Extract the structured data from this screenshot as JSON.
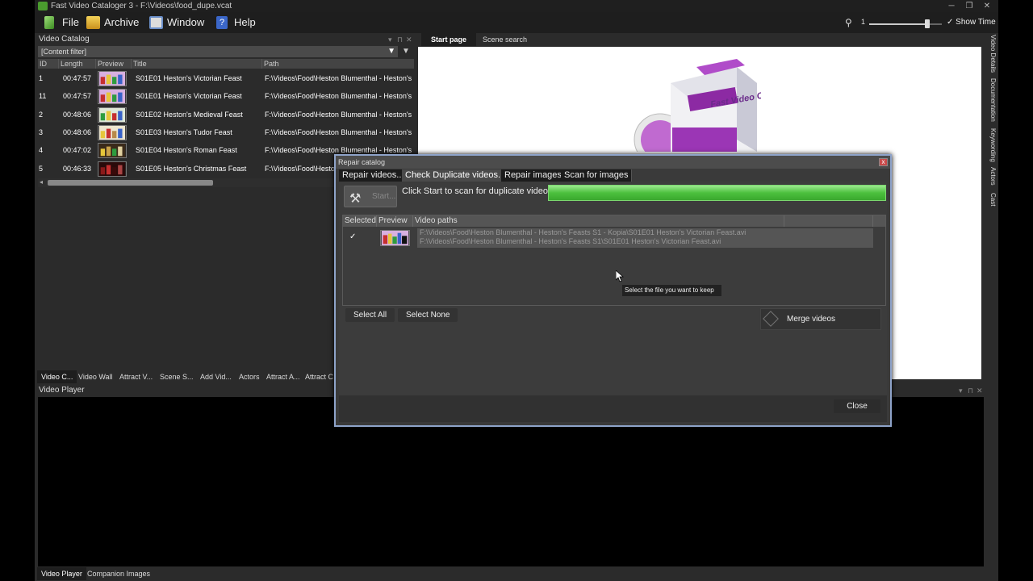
{
  "window": {
    "title": "Fast Video Cataloger 3 - F:\\Videos\\food_dupe.vcat"
  },
  "menu": {
    "file": "File",
    "archive": "Archive",
    "window": "Window",
    "help": "Help"
  },
  "toolbar": {
    "zoom_label": "1",
    "zoom_fraction": 0.8,
    "show_time": "Show Time",
    "show_time_check": "✓"
  },
  "catalog": {
    "title": "Video Catalog",
    "filter": "[Content filter]",
    "columns": {
      "id": "ID",
      "length": "Length",
      "preview": "Preview",
      "title": "Title",
      "path": "Path"
    },
    "rows": [
      {
        "id": "1",
        "length": "00:47:57",
        "title": "S01E01 Heston's Victorian Feast",
        "path": "F:\\Videos\\Food\\Heston Blumenthal - Heston's Fe"
      },
      {
        "id": "11",
        "length": "00:47:57",
        "title": "S01E01 Heston's Victorian Feast",
        "path": "F:\\Videos\\Food\\Heston Blumenthal - Heston's Fe"
      },
      {
        "id": "2",
        "length": "00:48:06",
        "title": "S01E02 Heston's Medieval Feast",
        "path": "F:\\Videos\\Food\\Heston Blumenthal - Heston's Fe"
      },
      {
        "id": "3",
        "length": "00:48:06",
        "title": "S01E03 Heston's Tudor Feast",
        "path": "F:\\Videos\\Food\\Heston Blumenthal - Heston's Fe"
      },
      {
        "id": "4",
        "length": "00:47:02",
        "title": "S01E04 Heston's Roman Feast",
        "path": "F:\\Videos\\Food\\Heston Blumenthal - Heston's Fe"
      },
      {
        "id": "5",
        "length": "00:46:33",
        "title": "S01E05 Heston's Christmas Feast",
        "path": "F:\\Videos\\Food\\Heston Blumenthal - Heston's Fe"
      }
    ],
    "tabs": [
      "Video C...",
      "Video Wall",
      "Attract V...",
      "Scene S...",
      "Add Vid...",
      "Actors",
      "Attract A...",
      "Attract C"
    ]
  },
  "startpage": {
    "tabs": [
      "Start page",
      "Scene search"
    ],
    "box_brand": "Fast Video Cataloger"
  },
  "side_tabs": [
    "Video Details",
    "Documentation",
    "Keywording",
    "Actors",
    "Cast"
  ],
  "player": {
    "title": "Video Player",
    "tabs": [
      "Video Player",
      "Companion Images"
    ]
  },
  "dialog": {
    "title": "Repair catalog",
    "tabs": [
      "Repair videos...",
      "Check Duplicate videos...",
      "Repair images",
      "Scan for images"
    ],
    "start_label": "Start...",
    "scan_message": "Click Start to scan for duplicate videos...",
    "progress_fraction": 1.0,
    "columns": {
      "selected": "Selected",
      "preview": "Preview",
      "paths": "Video paths"
    },
    "duplicate": {
      "checked": "✓",
      "path1": "F:\\Videos\\Food\\Heston Blumenthal - Heston's Feasts S1 - Kopia\\S01E01 Heston's Victorian Feast.avi",
      "path2": "F:\\Videos\\Food\\Heston Blumenthal - Heston's Feasts S1\\S01E01 Heston's Victorian Feast.avi"
    },
    "tooltip": "Select the file you want to keep",
    "select_all": "Select All",
    "select_none": "Select None",
    "merge": "Merge videos",
    "close": "Close"
  },
  "colors": {
    "accent_progress": "#56c04a",
    "dialog_border": "#8ea3c9"
  }
}
